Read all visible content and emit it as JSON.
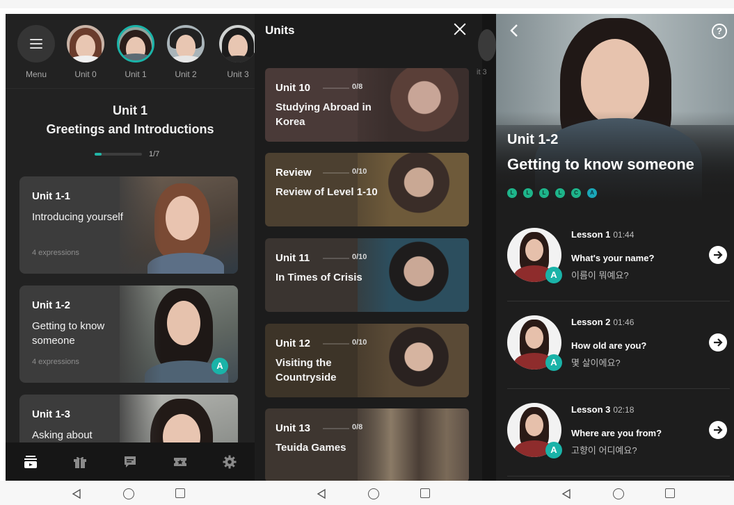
{
  "screen1": {
    "avatars": [
      {
        "label": "Menu"
      },
      {
        "label": "Unit 0"
      },
      {
        "label": "Unit 1"
      },
      {
        "label": "Unit 2"
      },
      {
        "label": "Unit 3"
      }
    ],
    "unit_code": "Unit 1",
    "unit_title": "Greetings  and Introductions",
    "progress_text": "1/7",
    "progress_fraction": 0.14,
    "lessons": [
      {
        "code": "Unit 1-1",
        "title": "Introducing yourself",
        "expressions": "4 expressions",
        "badge": ""
      },
      {
        "code": "Unit 1-2",
        "title": "Getting to know someone",
        "expressions": "4 expressions",
        "badge": "A"
      },
      {
        "code": "Unit 1-3",
        "title": "Asking about",
        "expressions": "",
        "badge": ""
      }
    ],
    "nav_icons": [
      "lessons-icon",
      "gift-icon",
      "chat-icon",
      "ticket-icon",
      "gear-icon"
    ]
  },
  "screen2": {
    "header": "Units",
    "peek_label": "it 3",
    "units": [
      {
        "code": "Unit 10",
        "count": "0/8",
        "title": "Studying Abroad in Korea",
        "color": "#4a3a38"
      },
      {
        "code": "Review",
        "count": "0/10",
        "title": "Review of Level 1-10",
        "color": "#4c4030"
      },
      {
        "code": "Unit 11",
        "count": "0/10",
        "title": "In Times of Crisis",
        "color": "#3a3430"
      },
      {
        "code": "Unit 12",
        "count": "0/10",
        "title": "Visiting the Countryside",
        "color": "#3d3428"
      },
      {
        "code": "Unit 13",
        "count": "0/8",
        "title": "Teuida Games",
        "color": "#3e3630"
      }
    ]
  },
  "screen3": {
    "code": "Unit 1-2",
    "title": "Getting to know  someone",
    "dots": [
      "L",
      "L",
      "L",
      "L",
      "C",
      "A"
    ],
    "lessons": [
      {
        "label": "Lesson 1",
        "duration": "01:44",
        "english": "What's your name?",
        "korean": "이름이 뭐예요?",
        "badge": "A"
      },
      {
        "label": "Lesson 2",
        "duration": "01:46",
        "english": "How old are you?",
        "korean": "몇 살이에요?",
        "badge": "A"
      },
      {
        "label": "Lesson 3",
        "duration": "02:18",
        "english": "Where are you from?",
        "korean": "고향이 어디예요?",
        "badge": "A"
      }
    ]
  },
  "colors": {
    "accent_teal": "#1ab3a8",
    "dot_green": "#1eb48a",
    "card_bg": "#3c3c3c",
    "screen_bg": "#222222"
  }
}
